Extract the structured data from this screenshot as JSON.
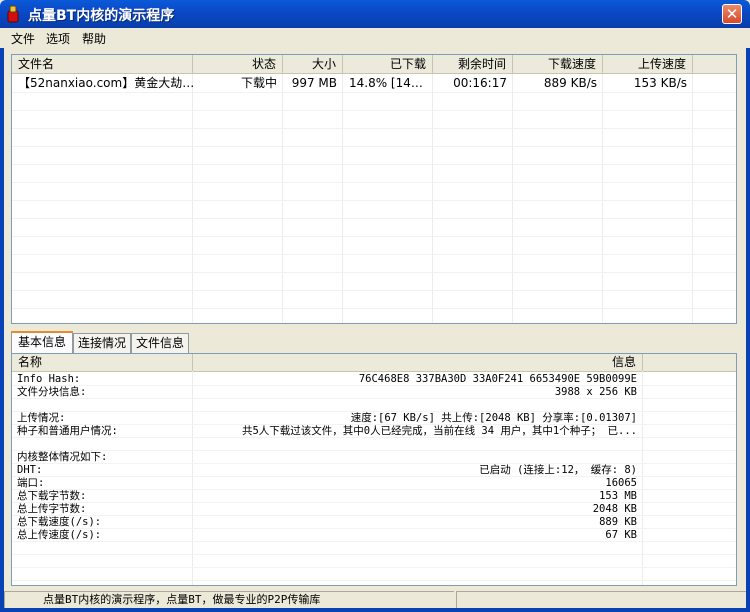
{
  "window": {
    "title": "点量BT内核的演示程序",
    "close_glyph": "✕"
  },
  "menu": [
    "文件",
    "选项",
    "帮助"
  ],
  "list": {
    "columns": [
      "文件名",
      "状态",
      "大小",
      "已下载",
      "剩余时间",
      "下载速度",
      "上传速度"
    ],
    "rows": [
      [
        "【52nanxiao.com】黄金大劫…",
        "下载中",
        "997 MB",
        "14.8% [14…",
        "00:16:17",
        "889 KB/s",
        "153 KB/s"
      ]
    ]
  },
  "tabs": [
    "基本信息",
    "连接情况",
    "文件信息"
  ],
  "info": {
    "columns": [
      "名称",
      "信息"
    ],
    "rows": [
      {
        "name": "Info Hash:",
        "value": "76C468E8 337BA30D 33A0F241 6653490E 59B0099E"
      },
      {
        "name": "文件分块信息:",
        "value": "3988 x 256 KB"
      },
      {
        "name": "",
        "value": ""
      },
      {
        "name": "上传情况:",
        "value": "速度:[67 KB/s]  共上传:[2048 KB]  分享率:[0.01307]"
      },
      {
        "name": "种子和普通用户情况:",
        "value": "共5人下载过该文件，其中0人已经完成，当前在线 34 用户，其中1个种子； 已..."
      },
      {
        "name": "",
        "value": ""
      },
      {
        "name": "内核整体情况如下:",
        "value": ""
      },
      {
        "name": "DHT:",
        "value": "已启动 (连接上:12， 缓存: 8)"
      },
      {
        "name": "端口:",
        "value": "16065"
      },
      {
        "name": "总下载字节数:",
        "value": "153 MB"
      },
      {
        "name": "总上传字节数:",
        "value": "2048 KB"
      },
      {
        "name": "总下载速度(/s):",
        "value": "889 KB"
      },
      {
        "name": "总上传速度(/s):",
        "value": "67 KB"
      }
    ]
  },
  "status": {
    "message": "点量BT内核的演示程序，点量BT，做最专业的P2P传输库"
  }
}
